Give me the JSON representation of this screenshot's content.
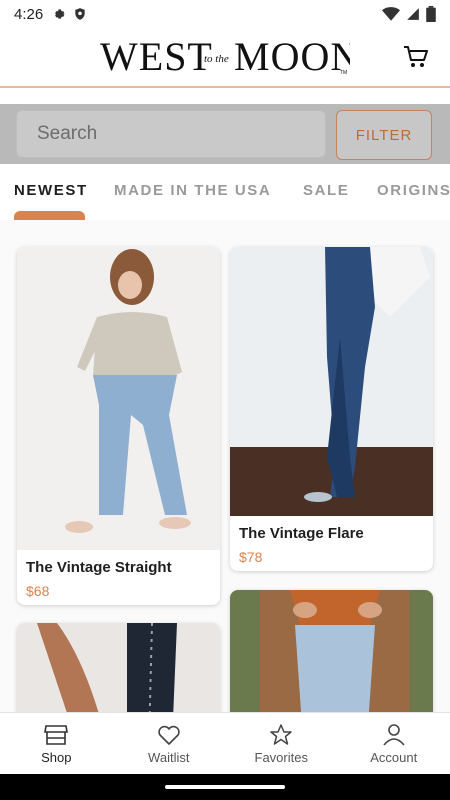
{
  "status": {
    "time": "4:26"
  },
  "header": {
    "logo_text": "WEST",
    "logo_script": "to the",
    "logo_text2": "MOON",
    "tm": "TM"
  },
  "search": {
    "placeholder": "Search",
    "filter_label": "FILTER"
  },
  "tabs": [
    {
      "label": "NEWEST",
      "active": true
    },
    {
      "label": "MADE IN THE USA",
      "active": false
    },
    {
      "label": "SALE",
      "active": false
    },
    {
      "label": "ORIGINS",
      "active": false
    }
  ],
  "products": [
    {
      "title": "The Vintage Straight",
      "price": "$68"
    },
    {
      "title": "The Vintage Flare",
      "price": "$78"
    }
  ],
  "nav": [
    {
      "label": "Shop",
      "icon": "shop-icon"
    },
    {
      "label": "Waitlist",
      "icon": "heart-icon"
    },
    {
      "label": "Favorites",
      "icon": "star-icon"
    },
    {
      "label": "Account",
      "icon": "person-icon"
    }
  ],
  "colors": {
    "accent": "#d9844f",
    "searchbar": "#b9b9b9"
  }
}
